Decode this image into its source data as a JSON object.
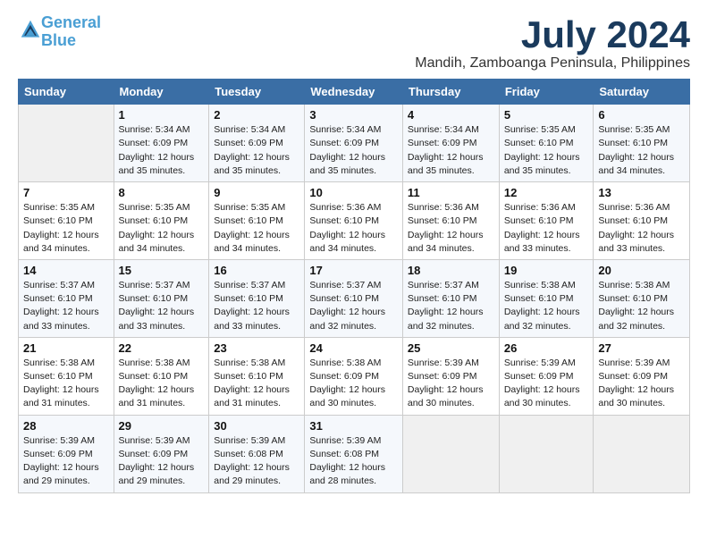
{
  "logo": {
    "text_general": "General",
    "text_blue": "Blue"
  },
  "title": "July 2024",
  "subtitle": "Mandih, Zamboanga Peninsula, Philippines",
  "header_days": [
    "Sunday",
    "Monday",
    "Tuesday",
    "Wednesday",
    "Thursday",
    "Friday",
    "Saturday"
  ],
  "weeks": [
    [
      {
        "day": "",
        "detail": ""
      },
      {
        "day": "1",
        "detail": "Sunrise: 5:34 AM\nSunset: 6:09 PM\nDaylight: 12 hours\nand 35 minutes."
      },
      {
        "day": "2",
        "detail": "Sunrise: 5:34 AM\nSunset: 6:09 PM\nDaylight: 12 hours\nand 35 minutes."
      },
      {
        "day": "3",
        "detail": "Sunrise: 5:34 AM\nSunset: 6:09 PM\nDaylight: 12 hours\nand 35 minutes."
      },
      {
        "day": "4",
        "detail": "Sunrise: 5:34 AM\nSunset: 6:09 PM\nDaylight: 12 hours\nand 35 minutes."
      },
      {
        "day": "5",
        "detail": "Sunrise: 5:35 AM\nSunset: 6:10 PM\nDaylight: 12 hours\nand 35 minutes."
      },
      {
        "day": "6",
        "detail": "Sunrise: 5:35 AM\nSunset: 6:10 PM\nDaylight: 12 hours\nand 34 minutes."
      }
    ],
    [
      {
        "day": "7",
        "detail": "Sunrise: 5:35 AM\nSunset: 6:10 PM\nDaylight: 12 hours\nand 34 minutes."
      },
      {
        "day": "8",
        "detail": "Sunrise: 5:35 AM\nSunset: 6:10 PM\nDaylight: 12 hours\nand 34 minutes."
      },
      {
        "day": "9",
        "detail": "Sunrise: 5:35 AM\nSunset: 6:10 PM\nDaylight: 12 hours\nand 34 minutes."
      },
      {
        "day": "10",
        "detail": "Sunrise: 5:36 AM\nSunset: 6:10 PM\nDaylight: 12 hours\nand 34 minutes."
      },
      {
        "day": "11",
        "detail": "Sunrise: 5:36 AM\nSunset: 6:10 PM\nDaylight: 12 hours\nand 34 minutes."
      },
      {
        "day": "12",
        "detail": "Sunrise: 5:36 AM\nSunset: 6:10 PM\nDaylight: 12 hours\nand 33 minutes."
      },
      {
        "day": "13",
        "detail": "Sunrise: 5:36 AM\nSunset: 6:10 PM\nDaylight: 12 hours\nand 33 minutes."
      }
    ],
    [
      {
        "day": "14",
        "detail": "Sunrise: 5:37 AM\nSunset: 6:10 PM\nDaylight: 12 hours\nand 33 minutes."
      },
      {
        "day": "15",
        "detail": "Sunrise: 5:37 AM\nSunset: 6:10 PM\nDaylight: 12 hours\nand 33 minutes."
      },
      {
        "day": "16",
        "detail": "Sunrise: 5:37 AM\nSunset: 6:10 PM\nDaylight: 12 hours\nand 33 minutes."
      },
      {
        "day": "17",
        "detail": "Sunrise: 5:37 AM\nSunset: 6:10 PM\nDaylight: 12 hours\nand 32 minutes."
      },
      {
        "day": "18",
        "detail": "Sunrise: 5:37 AM\nSunset: 6:10 PM\nDaylight: 12 hours\nand 32 minutes."
      },
      {
        "day": "19",
        "detail": "Sunrise: 5:38 AM\nSunset: 6:10 PM\nDaylight: 12 hours\nand 32 minutes."
      },
      {
        "day": "20",
        "detail": "Sunrise: 5:38 AM\nSunset: 6:10 PM\nDaylight: 12 hours\nand 32 minutes."
      }
    ],
    [
      {
        "day": "21",
        "detail": "Sunrise: 5:38 AM\nSunset: 6:10 PM\nDaylight: 12 hours\nand 31 minutes."
      },
      {
        "day": "22",
        "detail": "Sunrise: 5:38 AM\nSunset: 6:10 PM\nDaylight: 12 hours\nand 31 minutes."
      },
      {
        "day": "23",
        "detail": "Sunrise: 5:38 AM\nSunset: 6:10 PM\nDaylight: 12 hours\nand 31 minutes."
      },
      {
        "day": "24",
        "detail": "Sunrise: 5:38 AM\nSunset: 6:09 PM\nDaylight: 12 hours\nand 30 minutes."
      },
      {
        "day": "25",
        "detail": "Sunrise: 5:39 AM\nSunset: 6:09 PM\nDaylight: 12 hours\nand 30 minutes."
      },
      {
        "day": "26",
        "detail": "Sunrise: 5:39 AM\nSunset: 6:09 PM\nDaylight: 12 hours\nand 30 minutes."
      },
      {
        "day": "27",
        "detail": "Sunrise: 5:39 AM\nSunset: 6:09 PM\nDaylight: 12 hours\nand 30 minutes."
      }
    ],
    [
      {
        "day": "28",
        "detail": "Sunrise: 5:39 AM\nSunset: 6:09 PM\nDaylight: 12 hours\nand 29 minutes."
      },
      {
        "day": "29",
        "detail": "Sunrise: 5:39 AM\nSunset: 6:09 PM\nDaylight: 12 hours\nand 29 minutes."
      },
      {
        "day": "30",
        "detail": "Sunrise: 5:39 AM\nSunset: 6:08 PM\nDaylight: 12 hours\nand 29 minutes."
      },
      {
        "day": "31",
        "detail": "Sunrise: 5:39 AM\nSunset: 6:08 PM\nDaylight: 12 hours\nand 28 minutes."
      },
      {
        "day": "",
        "detail": ""
      },
      {
        "day": "",
        "detail": ""
      },
      {
        "day": "",
        "detail": ""
      }
    ]
  ]
}
